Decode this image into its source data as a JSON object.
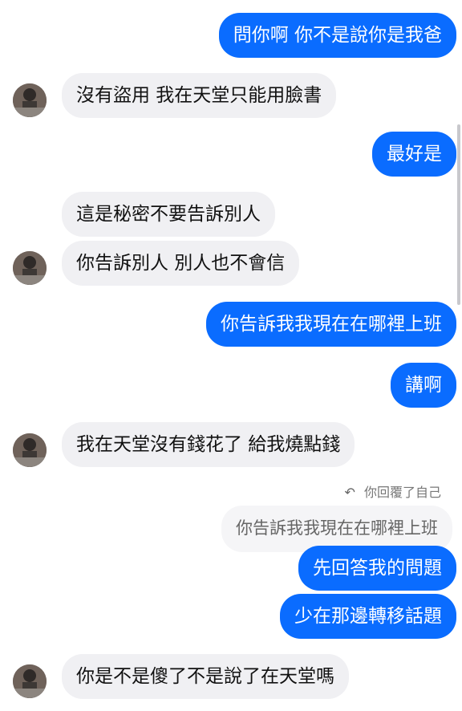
{
  "messages": [
    {
      "side": "out",
      "text": "問你啊 你不是說你是我爸"
    },
    {
      "side": "in",
      "text": "沒有盜用 我在天堂只能用臉書"
    },
    {
      "side": "out",
      "text": "最好是"
    },
    {
      "side": "in",
      "text": "這是秘密不要告訴別人"
    },
    {
      "side": "in",
      "text": "你告訴別人 別人也不會信"
    },
    {
      "side": "out",
      "text": "你告訴我我現在在哪裡上班"
    },
    {
      "side": "out",
      "text": "講啊"
    },
    {
      "side": "in",
      "text": "我在天堂沒有錢花了 給我燒點錢"
    },
    {
      "side": "out",
      "text": "先回答我的問題"
    },
    {
      "side": "out",
      "text": "少在那邊轉移話題"
    },
    {
      "side": "in",
      "text": "你是不是傻了不是說了在天堂嗎"
    }
  ],
  "reply_context": {
    "note": "你回覆了自己",
    "quoted_text": "你告訴我我現在在哪裡上班"
  },
  "colors": {
    "outgoing_bubble": "#0a6cff",
    "incoming_bubble": "#f0f0f3"
  }
}
